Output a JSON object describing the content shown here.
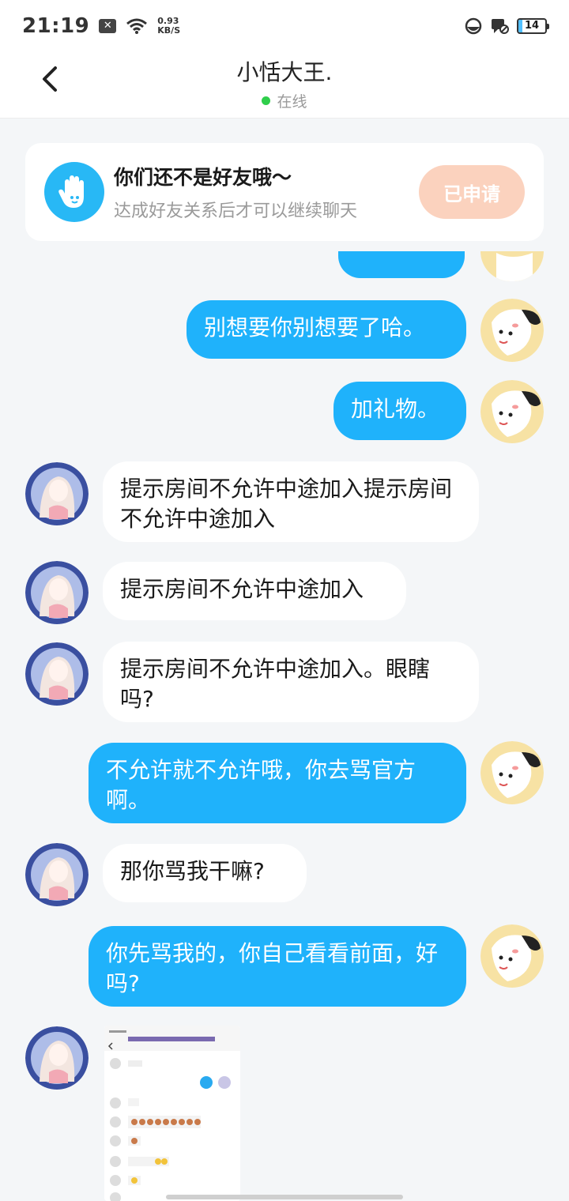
{
  "status_bar": {
    "time": "21:19",
    "net_speed": "0.93",
    "net_unit": "KB/S",
    "battery": "14"
  },
  "header": {
    "title": "小恬大王.",
    "status": "在线",
    "back_icon": "chevron-left-icon"
  },
  "friend_notice": {
    "title": "你们还不是好友哦～",
    "subtitle": "达成好友关系后才可以继续聊天",
    "button": "已申请",
    "icon": "hand-wave-icon"
  },
  "messages": [
    {
      "side": "out",
      "text": "别想要你别想要了哈。"
    },
    {
      "side": "out",
      "text": "加礼物。"
    },
    {
      "side": "in",
      "text": "提示房间不允许中途加入提示房间不允许中途加入"
    },
    {
      "side": "in",
      "text": "提示房间不允许中途加入"
    },
    {
      "side": "in",
      "text": "提示房间不允许中途加入。眼瞎吗?"
    },
    {
      "side": "out",
      "text": "不允许就不允许哦，你去骂官方啊。"
    },
    {
      "side": "in",
      "text": "那你骂我干嘛?"
    },
    {
      "side": "out",
      "text": "你先骂我的，你自己看看前面，好吗?"
    }
  ],
  "colors": {
    "outgoing_bubble": "#1fb2fb",
    "incoming_bubble": "#ffffff",
    "background": "#f4f6f8",
    "applied_button": "#fbd2be"
  }
}
